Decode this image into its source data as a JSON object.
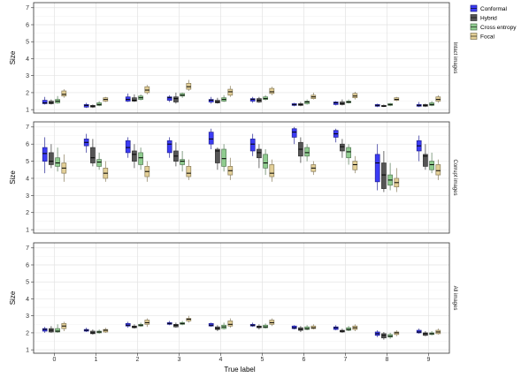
{
  "chart_data": {
    "type": "box",
    "xlabel": "True label",
    "ylabel": "Size",
    "categories": [
      "0",
      "1",
      "2",
      "3",
      "4",
      "5",
      "6",
      "7",
      "8",
      "9"
    ],
    "ylim": [
      0.8,
      7.3
    ],
    "yticks": [
      1,
      2,
      3,
      4,
      5,
      6,
      7
    ],
    "grid": true,
    "legend_position": "top-right",
    "series": [
      {
        "name": "Conformal",
        "color": "#3b3bf5"
      },
      {
        "name": "Hybrid",
        "color": "#555555"
      },
      {
        "name": "Cross entropy",
        "color": "#8fcc8f"
      },
      {
        "name": "Focal",
        "color": "#e3cf97"
      }
    ],
    "panels": [
      {
        "label": "Intact images",
        "boxes": [
          [
            [
              1.3,
              1.35,
              1.4,
              1.55,
              1.75
            ],
            [
              1.3,
              1.35,
              1.4,
              1.5,
              1.6
            ],
            [
              1.35,
              1.4,
              1.5,
              1.6,
              1.8
            ],
            [
              1.7,
              1.8,
              1.9,
              2.1,
              2.2
            ]
          ],
          [
            [
              1.1,
              1.15,
              1.25,
              1.3,
              1.4
            ],
            [
              1.1,
              1.15,
              1.2,
              1.25,
              1.3
            ],
            [
              1.2,
              1.25,
              1.3,
              1.4,
              1.5
            ],
            [
              1.45,
              1.5,
              1.6,
              1.7,
              1.75
            ]
          ],
          [
            [
              1.45,
              1.5,
              1.6,
              1.75,
              1.95
            ],
            [
              1.45,
              1.5,
              1.55,
              1.7,
              1.9
            ],
            [
              1.55,
              1.6,
              1.7,
              1.8,
              1.9
            ],
            [
              1.9,
              2.0,
              2.15,
              2.35,
              2.45
            ]
          ],
          [
            [
              1.45,
              1.55,
              1.7,
              1.75,
              1.85
            ],
            [
              1.35,
              1.45,
              1.65,
              1.75,
              2.0
            ],
            [
              1.7,
              1.8,
              1.85,
              1.95,
              2.0
            ],
            [
              2.1,
              2.2,
              2.35,
              2.55,
              2.75
            ]
          ],
          [
            [
              1.35,
              1.45,
              1.55,
              1.6,
              1.75
            ],
            [
              1.35,
              1.4,
              1.45,
              1.55,
              1.7
            ],
            [
              1.45,
              1.5,
              1.6,
              1.7,
              1.85
            ],
            [
              1.75,
              1.85,
              2.05,
              2.2,
              2.4
            ]
          ],
          [
            [
              1.4,
              1.5,
              1.6,
              1.65,
              1.75
            ],
            [
              1.4,
              1.45,
              1.55,
              1.65,
              1.75
            ],
            [
              1.55,
              1.6,
              1.65,
              1.75,
              1.85
            ],
            [
              1.85,
              1.95,
              2.05,
              2.25,
              2.35
            ]
          ],
          [
            [
              1.2,
              1.25,
              1.3,
              1.35,
              1.4
            ],
            [
              1.2,
              1.25,
              1.3,
              1.35,
              1.45
            ],
            [
              1.3,
              1.35,
              1.45,
              1.5,
              1.6
            ],
            [
              1.6,
              1.65,
              1.75,
              1.85,
              2.0
            ]
          ],
          [
            [
              1.25,
              1.3,
              1.4,
              1.45,
              1.5
            ],
            [
              1.25,
              1.3,
              1.35,
              1.45,
              1.6
            ],
            [
              1.35,
              1.4,
              1.45,
              1.5,
              1.6
            ],
            [
              1.6,
              1.7,
              1.8,
              1.95,
              2.05
            ]
          ],
          [
            [
              1.15,
              1.2,
              1.25,
              1.3,
              1.35
            ],
            [
              1.15,
              1.2,
              1.2,
              1.25,
              1.3
            ],
            [
              1.2,
              1.25,
              1.3,
              1.35,
              1.4
            ],
            [
              1.5,
              1.55,
              1.6,
              1.7,
              1.75
            ]
          ],
          [
            [
              1.15,
              1.2,
              1.25,
              1.3,
              1.45
            ],
            [
              1.15,
              1.2,
              1.25,
              1.3,
              1.35
            ],
            [
              1.2,
              1.25,
              1.3,
              1.4,
              1.5
            ],
            [
              1.4,
              1.5,
              1.6,
              1.75,
              1.85
            ]
          ]
        ]
      },
      {
        "label": "Corrupt images",
        "boxes": [
          [
            [
              4.3,
              5.0,
              5.45,
              5.8,
              6.4
            ],
            [
              4.6,
              4.8,
              5.0,
              5.5,
              6.0
            ],
            [
              4.4,
              4.7,
              4.9,
              5.2,
              5.8
            ],
            [
              3.8,
              4.3,
              4.6,
              4.9,
              5.4
            ]
          ],
          [
            [
              5.5,
              5.9,
              6.1,
              6.3,
              6.6
            ],
            [
              4.7,
              4.9,
              5.2,
              5.8,
              6.3
            ],
            [
              4.5,
              4.7,
              4.95,
              5.1,
              5.5
            ],
            [
              3.8,
              4.0,
              4.3,
              4.6,
              5.0
            ]
          ],
          [
            [
              5.2,
              5.5,
              5.8,
              6.2,
              6.4
            ],
            [
              4.6,
              5.0,
              5.4,
              5.6,
              6.0
            ],
            [
              4.5,
              4.8,
              5.2,
              5.5,
              5.8
            ],
            [
              3.8,
              4.1,
              4.4,
              4.7,
              5.0
            ]
          ],
          [
            [
              5.2,
              5.5,
              6.0,
              6.2,
              6.4
            ],
            [
              4.7,
              5.0,
              5.3,
              5.6,
              6.1
            ],
            [
              4.4,
              4.8,
              5.0,
              5.1,
              5.6
            ],
            [
              3.9,
              4.1,
              4.3,
              4.7,
              5.1
            ]
          ],
          [
            [
              5.7,
              6.0,
              6.3,
              6.7,
              6.9
            ],
            [
              4.5,
              4.9,
              5.6,
              5.7,
              5.8
            ],
            [
              4.4,
              4.7,
              5.15,
              5.7,
              6.0
            ],
            [
              3.9,
              4.2,
              4.45,
              4.7,
              5.2
            ]
          ],
          [
            [
              5.3,
              5.6,
              6.0,
              6.3,
              6.6
            ],
            [
              4.6,
              5.2,
              5.5,
              5.7,
              6.0
            ],
            [
              4.2,
              4.6,
              4.9,
              5.4,
              5.7
            ],
            [
              3.8,
              4.1,
              4.3,
              4.8,
              5.1
            ]
          ],
          [
            [
              6.0,
              6.4,
              6.7,
              6.9,
              7.0
            ],
            [
              4.9,
              5.3,
              5.7,
              6.1,
              6.4
            ],
            [
              5.0,
              5.3,
              5.5,
              5.8,
              6.0
            ],
            [
              4.2,
              4.4,
              4.6,
              4.8,
              5.0
            ]
          ],
          [
            [
              6.1,
              6.4,
              6.6,
              6.8,
              6.9
            ],
            [
              5.2,
              5.6,
              5.85,
              6.0,
              6.3
            ],
            [
              4.8,
              5.2,
              5.55,
              5.8,
              6.0
            ],
            [
              4.3,
              4.5,
              4.8,
              5.0,
              5.3
            ]
          ],
          [
            [
              3.3,
              3.8,
              4.9,
              5.4,
              6.0
            ],
            [
              3.2,
              3.4,
              4.2,
              4.9,
              5.6
            ],
            [
              3.3,
              3.6,
              3.9,
              4.2,
              4.9
            ],
            [
              3.2,
              3.5,
              3.75,
              4.0,
              4.6
            ]
          ],
          [
            [
              5.0,
              5.6,
              5.9,
              6.2,
              6.5
            ],
            [
              4.5,
              4.7,
              5.3,
              5.4,
              6.0
            ],
            [
              4.3,
              4.5,
              4.8,
              5.0,
              5.5
            ],
            [
              3.9,
              4.2,
              4.45,
              4.8,
              5.1
            ]
          ]
        ]
      },
      {
        "label": "All images",
        "boxes": [
          [
            [
              2.0,
              2.1,
              2.2,
              2.25,
              2.35
            ],
            [
              2.0,
              2.05,
              2.15,
              2.25,
              2.4
            ],
            [
              2.0,
              2.05,
              2.1,
              2.25,
              2.5
            ],
            [
              2.1,
              2.25,
              2.4,
              2.55,
              2.65
            ]
          ],
          [
            [
              2.05,
              2.1,
              2.15,
              2.2,
              2.3
            ],
            [
              1.9,
              1.95,
              2.0,
              2.1,
              2.2
            ],
            [
              1.95,
              2.0,
              2.05,
              2.1,
              2.2
            ],
            [
              2.0,
              2.05,
              2.15,
              2.2,
              2.3
            ]
          ],
          [
            [
              2.3,
              2.4,
              2.45,
              2.55,
              2.65
            ],
            [
              2.25,
              2.3,
              2.35,
              2.4,
              2.5
            ],
            [
              2.35,
              2.4,
              2.45,
              2.5,
              2.6
            ],
            [
              2.35,
              2.5,
              2.6,
              2.75,
              2.85
            ]
          ],
          [
            [
              2.45,
              2.5,
              2.55,
              2.6,
              2.7
            ],
            [
              2.3,
              2.35,
              2.45,
              2.5,
              2.6
            ],
            [
              2.45,
              2.5,
              2.55,
              2.6,
              2.7
            ],
            [
              2.6,
              2.7,
              2.8,
              2.85,
              3.0
            ]
          ],
          [
            [
              2.35,
              2.4,
              2.45,
              2.55,
              2.6
            ],
            [
              2.1,
              2.2,
              2.25,
              2.35,
              2.45
            ],
            [
              2.2,
              2.25,
              2.35,
              2.45,
              2.6
            ],
            [
              2.3,
              2.4,
              2.5,
              2.7,
              2.85
            ]
          ],
          [
            [
              2.35,
              2.4,
              2.45,
              2.5,
              2.6
            ],
            [
              2.2,
              2.3,
              2.35,
              2.4,
              2.5
            ],
            [
              2.25,
              2.3,
              2.35,
              2.45,
              2.55
            ],
            [
              2.4,
              2.5,
              2.6,
              2.75,
              2.85
            ]
          ],
          [
            [
              2.2,
              2.25,
              2.3,
              2.4,
              2.45
            ],
            [
              2.05,
              2.15,
              2.2,
              2.3,
              2.4
            ],
            [
              2.15,
              2.2,
              2.25,
              2.35,
              2.45
            ],
            [
              2.2,
              2.25,
              2.3,
              2.4,
              2.5
            ]
          ],
          [
            [
              2.15,
              2.2,
              2.3,
              2.35,
              2.45
            ],
            [
              2.0,
              2.05,
              2.1,
              2.15,
              2.25
            ],
            [
              2.1,
              2.15,
              2.2,
              2.3,
              2.4
            ],
            [
              2.1,
              2.2,
              2.3,
              2.4,
              2.5
            ]
          ],
          [
            [
              1.75,
              1.85,
              1.95,
              2.05,
              2.15
            ],
            [
              1.6,
              1.7,
              1.85,
              1.95,
              2.05
            ],
            [
              1.65,
              1.75,
              1.8,
              1.9,
              2.0
            ],
            [
              1.8,
              1.9,
              2.0,
              2.05,
              2.15
            ]
          ],
          [
            [
              1.95,
              2.0,
              2.05,
              2.15,
              2.25
            ],
            [
              1.8,
              1.85,
              1.95,
              2.0,
              2.1
            ],
            [
              1.85,
              1.9,
              1.95,
              2.0,
              2.1
            ],
            [
              1.9,
              1.95,
              2.05,
              2.15,
              2.25
            ]
          ]
        ]
      }
    ]
  }
}
